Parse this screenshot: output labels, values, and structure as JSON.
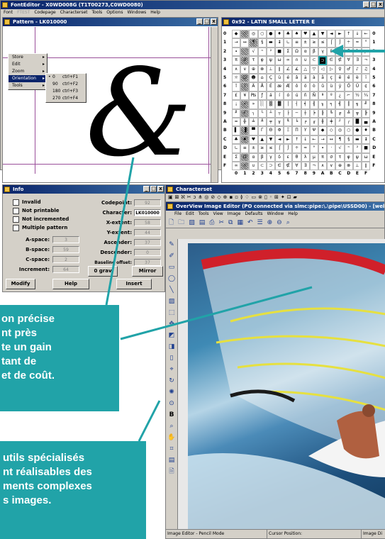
{
  "main_window": {
    "title": "FontEditor - X0WD008G (T1T00273,C0WD0080)",
    "menu": [
      "Font",
      "Codepage",
      "Characterset",
      "Tools",
      "Options",
      "Windows",
      "Help"
    ],
    "menu_disabled": "FTEST",
    "controls": [
      "_",
      "□",
      "x"
    ]
  },
  "pattern_window": {
    "title": "Pattern - LK010000",
    "glyph": "&",
    "context_menu": {
      "items": [
        "Store",
        "Edit",
        "Zoom",
        "Orientation",
        "Tools"
      ],
      "submenu": [
        {
          "label": "0",
          "shortcut": "ctrl+F1",
          "checked": true
        },
        {
          "label": "90",
          "shortcut": "ctrl+F2"
        },
        {
          "label": "180",
          "shortcut": "ctrl+F3"
        },
        {
          "label": "270",
          "shortcut": "ctrl+F4"
        }
      ]
    }
  },
  "grid_window": {
    "title": "0x92 - LATIN SMALL LETTER E",
    "rows": [
      "0",
      "1",
      "2",
      "3",
      "4",
      "5",
      "6",
      "7",
      "8",
      "9",
      "A",
      "B",
      "C",
      "D",
      "E",
      "F"
    ],
    "cols": [
      "0",
      "1",
      "2",
      "3",
      "4",
      "5",
      "6",
      "7",
      "8",
      "9",
      "A",
      "B",
      "C",
      "D",
      "E",
      "F"
    ],
    "right_rows": [
      "0",
      "1",
      "2",
      "3",
      "4",
      "5",
      "6",
      "7",
      "8",
      "9",
      "A",
      "B",
      "C",
      "D",
      "E",
      "F"
    ]
  },
  "info_window": {
    "title": "Info",
    "checkboxes": [
      "Invalid",
      "Not printable",
      "Not incremented",
      "Multiple pattern"
    ],
    "left_fields": [
      {
        "label": "A-space:",
        "value": "3"
      },
      {
        "label": "B-space:",
        "value": "59"
      },
      {
        "label": "C-space:",
        "value": "2"
      },
      {
        "label": "Increment:",
        "value": "64"
      }
    ],
    "right_fields": [
      {
        "label": "Codepoint:",
        "value": "92"
      },
      {
        "label": "Character:",
        "value": "LK010000"
      },
      {
        "label": "X-extent:",
        "value": "58"
      },
      {
        "label": "Y-extent:",
        "value": "44"
      },
      {
        "label": "Ascender:",
        "value": "37"
      },
      {
        "label": "Descender:",
        "value": "0"
      },
      {
        "label": "Baseline offset:",
        "value": "37"
      }
    ],
    "buttons": {
      "modify": "Modify",
      "help": "Help",
      "insert": "Insert",
      "zero_grav": "0 grav",
      "mirror": "Mirror"
    }
  },
  "charset_window": {
    "title": "Characterset"
  },
  "image_editor": {
    "title": "OverView Image Editor (PO connected via slmc:pipe:\\.\\pipe\\USSD00) - [webimage]",
    "menu": [
      "File",
      "Edit",
      "Tools",
      "View",
      "Image",
      "Defaults",
      "Window",
      "Help"
    ],
    "status": [
      "Image Editor - Pencil Mode",
      "Cursor Position:",
      "Image Di"
    ]
  },
  "callouts": {
    "top": [
      "on précise",
      "nt près",
      "te un gain",
      "tant de",
      "et de coût."
    ],
    "bottom": [
      "utils spécialisés",
      "nt réalisables des",
      "ments complexes",
      "s images."
    ]
  },
  "colors": {
    "teal": "#21a3a8",
    "titlebar": "#0a246a",
    "window": "#d4d0c8"
  }
}
